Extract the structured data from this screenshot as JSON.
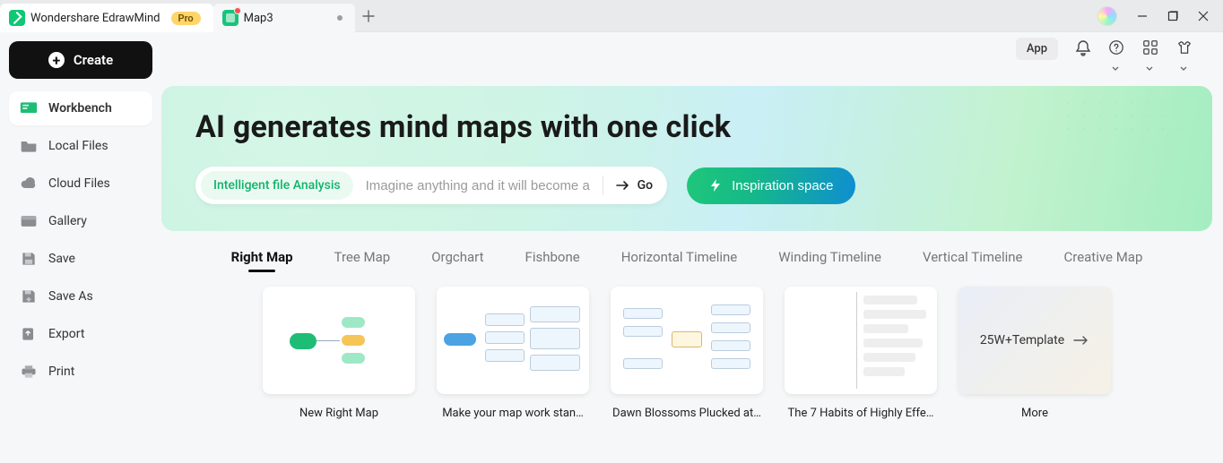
{
  "titlebar": {
    "app_name": "Wondershare EdrawMind",
    "pro_label": "Pro",
    "file_tab": "Map3"
  },
  "toolbar": {
    "app_chip": "App"
  },
  "sidebar": {
    "create": "Create",
    "items": [
      {
        "label": "Workbench",
        "icon": "workbench-icon"
      },
      {
        "label": "Local Files",
        "icon": "folder-icon"
      },
      {
        "label": "Cloud Files",
        "icon": "cloud-icon"
      },
      {
        "label": "Gallery",
        "icon": "gallery-icon"
      },
      {
        "label": "Save",
        "icon": "save-icon"
      },
      {
        "label": "Save As",
        "icon": "saveas-icon"
      },
      {
        "label": "Export",
        "icon": "export-icon"
      },
      {
        "label": "Print",
        "icon": "print-icon"
      }
    ]
  },
  "hero": {
    "title": "AI generates mind maps with one click",
    "mode_label": "Intelligent file Analysis",
    "placeholder": "Imagine anything and it will become a …",
    "go_label": "Go",
    "inspiration_label": "Inspiration space"
  },
  "templates": {
    "tabs": [
      "Right Map",
      "Tree Map",
      "Orgchart",
      "Fishbone",
      "Horizontal Timeline",
      "Winding Timeline",
      "Vertical Timeline",
      "Creative Map"
    ],
    "active_tab": 0,
    "cards": [
      {
        "label": "New Right Map"
      },
      {
        "label": "Make your map work stan…"
      },
      {
        "label": "Dawn Blossoms Plucked at…"
      },
      {
        "label": "The 7 Habits of Highly Effe…"
      },
      {
        "label": "More",
        "more_text": "25W+Template"
      }
    ]
  }
}
